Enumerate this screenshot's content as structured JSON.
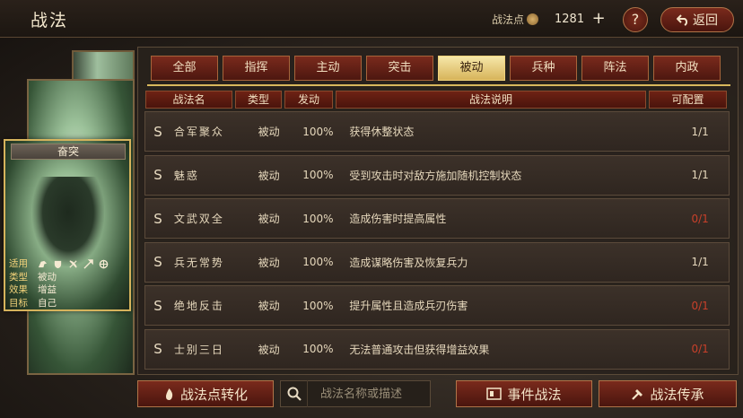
{
  "header": {
    "title": "战法",
    "points_label": "战法点",
    "points_value": "1281",
    "plus": "+",
    "help": "?",
    "back_label": "返回"
  },
  "card": {
    "skill_name": "奋突",
    "rows": [
      {
        "key": "适用",
        "value": ""
      },
      {
        "key": "类型",
        "value": "被动"
      },
      {
        "key": "效果",
        "value": "增益"
      },
      {
        "key": "目标",
        "value": "自己"
      }
    ],
    "troop_icons": [
      "cavalry-icon",
      "shield-icon",
      "bow-icon",
      "spear-icon",
      "siege-icon"
    ]
  },
  "tabs": [
    {
      "label": "全部",
      "active": false
    },
    {
      "label": "指挥",
      "active": false
    },
    {
      "label": "主动",
      "active": false
    },
    {
      "label": "突击",
      "active": false
    },
    {
      "label": "被动",
      "active": true
    },
    {
      "label": "兵种",
      "active": false
    },
    {
      "label": "阵法",
      "active": false
    },
    {
      "label": "内政",
      "active": false
    }
  ],
  "table": {
    "headers": [
      "战法名",
      "类型",
      "发动",
      "战法说明",
      "可配置"
    ],
    "rows": [
      {
        "rank": "S",
        "name": "合军聚众",
        "type": "被动",
        "rate": "100%",
        "desc": "获得休整状态",
        "cfg": "1/1",
        "cfg_red": false
      },
      {
        "rank": "S",
        "name": "魅惑",
        "type": "被动",
        "rate": "100%",
        "desc": "受到攻击时对敌方施加随机控制状态",
        "cfg": "1/1",
        "cfg_red": false
      },
      {
        "rank": "S",
        "name": "文武双全",
        "type": "被动",
        "rate": "100%",
        "desc": "造成伤害时提高属性",
        "cfg": "0/1",
        "cfg_red": true
      },
      {
        "rank": "S",
        "name": "兵无常势",
        "type": "被动",
        "rate": "100%",
        "desc": "造成谋略伤害及恢复兵力",
        "cfg": "1/1",
        "cfg_red": false
      },
      {
        "rank": "S",
        "name": "绝地反击",
        "type": "被动",
        "rate": "100%",
        "desc": "提升属性且造成兵刃伤害",
        "cfg": "0/1",
        "cfg_red": true
      },
      {
        "rank": "S",
        "name": "士别三日",
        "type": "被动",
        "rate": "100%",
        "desc": "无法普通攻击但获得增益效果",
        "cfg": "0/1",
        "cfg_red": true
      }
    ]
  },
  "bottom": {
    "convert_label": "战法点转化",
    "search_placeholder": "战法名称或描述",
    "event_label": "事件战法",
    "inherit_label": "战法传承"
  },
  "colors": {
    "accent_gold": "#d8b85c",
    "button_red": "#7a2a1c",
    "config_red": "#c8402a"
  }
}
